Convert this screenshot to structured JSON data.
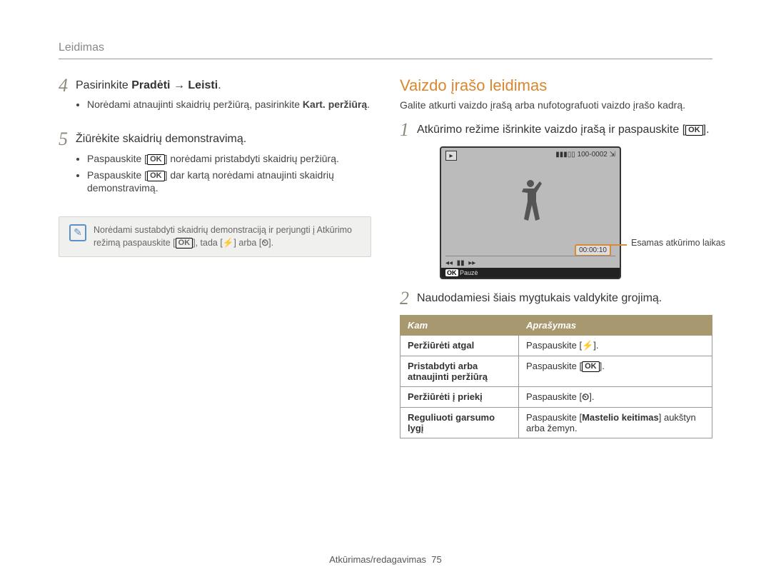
{
  "header": {
    "title": "Leidimas"
  },
  "left": {
    "step4": {
      "num": "4",
      "text_prefix": "Pasirinkite ",
      "strong1": "Pradėti",
      "arrow": " → ",
      "strong2": "Leisti",
      "suffix": "."
    },
    "step4_bullets": [
      {
        "pre": "Norėdami atnaujinti skaidrių peržiūrą, pasirinkite ",
        "strong": "Kart. peržiūrą",
        "post": "."
      }
    ],
    "step5": {
      "num": "5",
      "text": "Žiūrėkite skaidrių demonstravimą."
    },
    "step5_bullets": [
      {
        "pre": "Paspauskite [",
        "icon": "OK",
        "post": "] norėdami pristabdyti skaidrių peržiūrą."
      },
      {
        "pre": "Paspauskite [",
        "icon": "OK",
        "post": "] dar kartą norėdami atnaujinti skaidrių demonstravimą."
      }
    ],
    "note": {
      "pre": "Norėdami sustabdyti skaidrių demonstraciją ir perjungti į Atkūrimo režimą paspauskite [",
      "icon1": "OK",
      "mid1": "], tada [",
      "icon2": "⚡",
      "mid2": "] arba [",
      "icon3": "⏲",
      "post": "]."
    }
  },
  "right": {
    "title": "Vaizdo įrašo leidimas",
    "intro": "Galite atkurti vaizdo įrašą arba nufotografuoti vaizdo įrašo kadrą.",
    "step1": {
      "num": "1",
      "text_pre": "Atkūrimo režime išrinkite vaizdo įrašą ir paspauskite [",
      "icon": "OK",
      "text_post": "]."
    },
    "screenshot": {
      "top_right": "100-0002",
      "timer": "00:00:10",
      "pause": "Pauzė",
      "ok": "OK"
    },
    "callout": "Esamas atkūrimo laikas",
    "step2": {
      "num": "2",
      "text": "Naudodamiesi šiais mygtukais valdykite grojimą."
    },
    "table": {
      "head": {
        "c1": "Kam",
        "c2": "Aprašymas"
      },
      "rows": [
        {
          "k": "Peržiūrėti atgal",
          "pre": "Paspauskite [",
          "icon": "⚡",
          "post": "]."
        },
        {
          "k": "Pristabdyti arba atnaujinti peržiūrą",
          "pre": "Paspauskite [",
          "icon": "OK",
          "post": "]."
        },
        {
          "k": "Peržiūrėti į priekį",
          "pre": "Paspauskite [",
          "icon": "⏲",
          "post": "]."
        },
        {
          "k": "Reguliuoti garsumo lygį",
          "pre": "Paspauskite [",
          "strong": "Mastelio keitimas",
          "post": "] aukštyn arba žemyn."
        }
      ]
    }
  },
  "footer": {
    "label": "Atkūrimas/redagavimas",
    "page": "75"
  }
}
